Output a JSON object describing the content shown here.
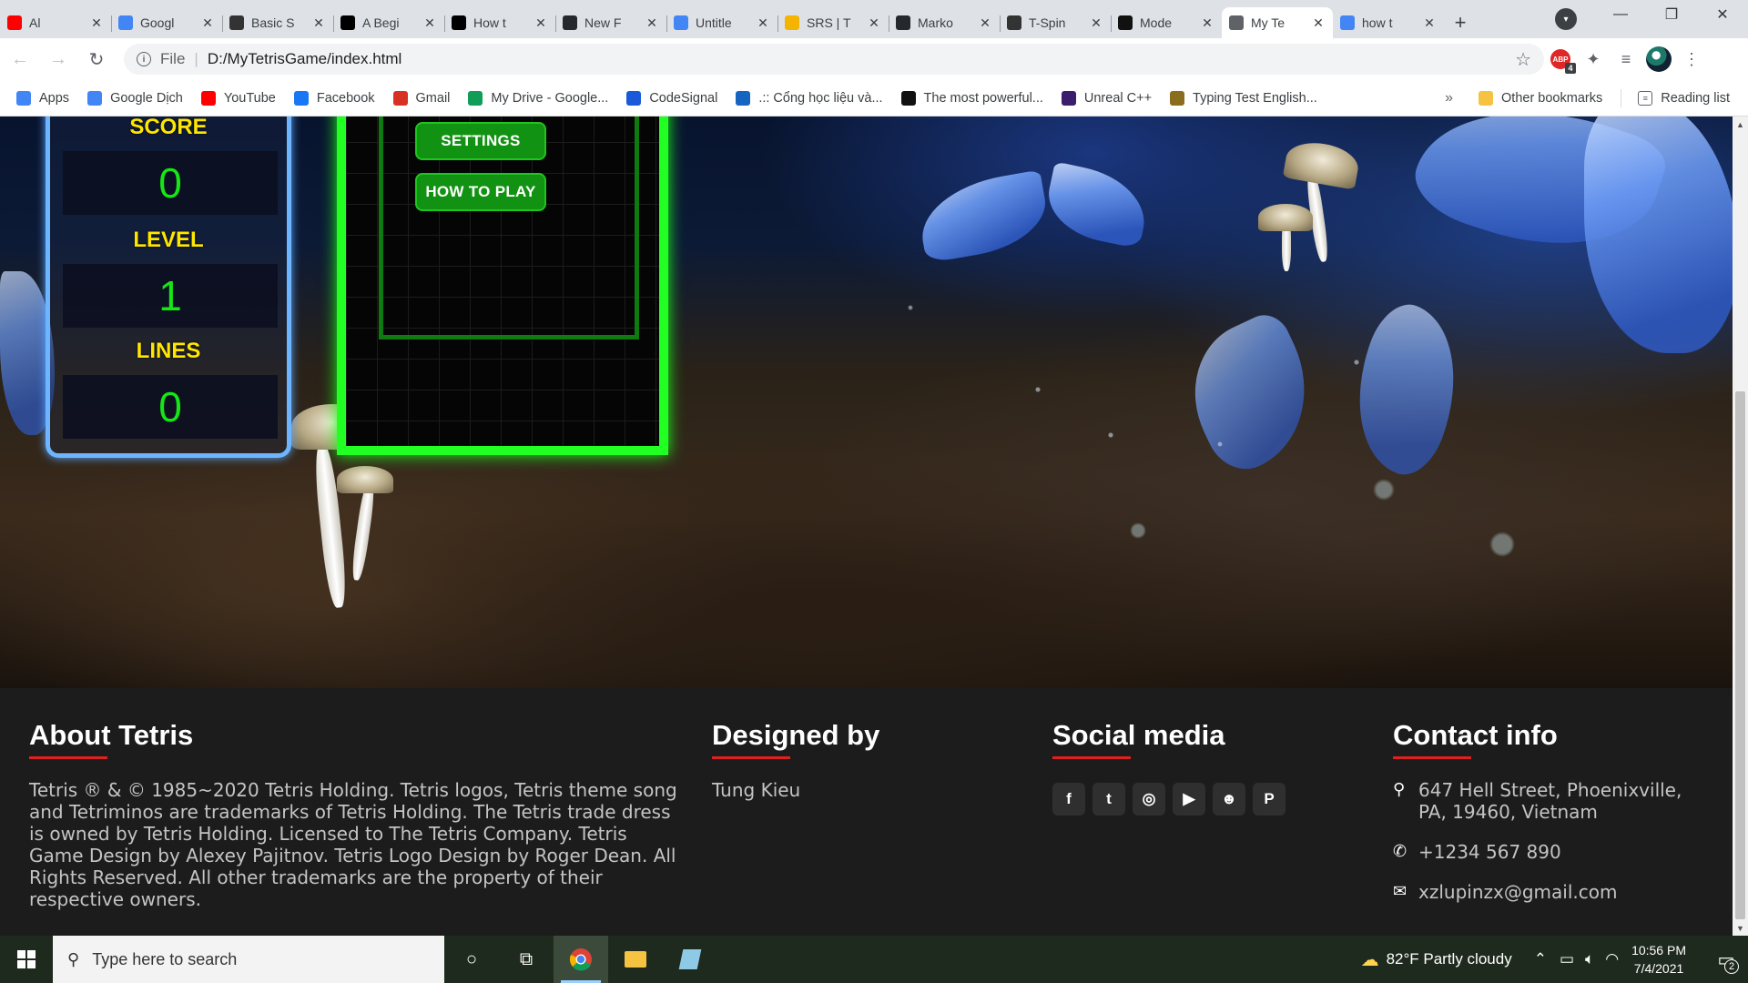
{
  "tabs": [
    {
      "title": "Al",
      "icon": "youtube-icon",
      "color": "#ff0000"
    },
    {
      "title": "Googl",
      "icon": "google-translate-icon",
      "color": "#4285f4"
    },
    {
      "title": "Basic S",
      "icon": "markdown-icon",
      "color": "#333333"
    },
    {
      "title": "A Begi",
      "icon": "medium-icon",
      "color": "#000000"
    },
    {
      "title": "How t",
      "icon": "dog-icon",
      "color": "#000000"
    },
    {
      "title": "New F",
      "icon": "github-icon",
      "color": "#24292e"
    },
    {
      "title": "Untitle",
      "icon": "google-docs-icon",
      "color": "#4285f4"
    },
    {
      "title": "SRS | T",
      "icon": "srs-icon",
      "color": "#f4b400"
    },
    {
      "title": "Marko",
      "icon": "github-icon",
      "color": "#24292e"
    },
    {
      "title": "T-Spin",
      "icon": "tspin-icon",
      "color": "#333333"
    },
    {
      "title": "Mode",
      "icon": "mode-icon",
      "color": "#111111"
    },
    {
      "title": "My Te",
      "icon": "globe-icon",
      "color": "#5f6368",
      "active": true
    },
    {
      "title": "how t",
      "icon": "google-icon",
      "color": "#4285f4"
    }
  ],
  "address": {
    "scheme_label": "File",
    "url": "D:/MyTetrisGame/index.html"
  },
  "extensions": {
    "abp_label": "ABP",
    "abp_badge": "4"
  },
  "bookmarks": [
    {
      "label": "Apps",
      "icon": "apps-grid-icon",
      "color": "#4285f4"
    },
    {
      "label": "Google Dịch",
      "icon": "google-translate-icon",
      "color": "#4285f4"
    },
    {
      "label": "YouTube",
      "icon": "youtube-icon",
      "color": "#ff0000"
    },
    {
      "label": "Facebook",
      "icon": "facebook-icon",
      "color": "#1877f2"
    },
    {
      "label": "Gmail",
      "icon": "gmail-icon",
      "color": "#d93025"
    },
    {
      "label": "My Drive - Google...",
      "icon": "google-drive-icon",
      "color": "#0f9d58"
    },
    {
      "label": "CodeSignal",
      "icon": "codesignal-icon",
      "color": "#1a5ad8"
    },
    {
      "label": ".:: Cổng học liệu và...",
      "icon": "portal-icon",
      "color": "#1565c0"
    },
    {
      "label": "The most powerful...",
      "icon": "unreal-icon",
      "color": "#111111"
    },
    {
      "label": "Unreal C++",
      "icon": "unreal-cpp-icon",
      "color": "#3b1d6e"
    },
    {
      "label": "Typing Test English...",
      "icon": "typing-test-icon",
      "color": "#8a6d1d"
    }
  ],
  "bookmarks_right": {
    "overflow": "»",
    "other": "Other bookmarks",
    "reading_list": "Reading list"
  },
  "game": {
    "score_label": "SCORE",
    "score": "0",
    "level_label": "LEVEL",
    "level": "1",
    "lines_label": "LINES",
    "lines": "0",
    "settings_button": "SETTINGS",
    "how_to_play_button": "HOW TO PLAY"
  },
  "footer": {
    "about_title": "About Tetris",
    "about_text": "Tetris ® & © 1985~2020 Tetris Holding. Tetris logos, Tetris theme song and Tetriminos are trademarks of Tetris Holding. The Tetris trade dress is owned by Tetris Holding. Licensed to The Tetris Company. Tetris Game Design by Alexey Pajitnov. Tetris Logo Design by Roger Dean. All Rights Reserved. All other trademarks are the property of their respective owners.",
    "designed_title": "Designed by",
    "designer": "Tung Kieu",
    "social_title": "Social media",
    "socials": [
      "facebook-icon",
      "twitter-icon",
      "instagram-icon",
      "youtube-icon",
      "snapchat-icon",
      "pinterest-icon"
    ],
    "contact_title": "Contact info",
    "address": "647 Hell Street, Phoenixville, PA, 19460, Vietnam",
    "phone": "+1234 567 890",
    "email": "xzlupinzx@gmail.com",
    "accent_color": "#e02020"
  },
  "taskbar": {
    "search_placeholder": "Type here to search",
    "weather": "82°F  Partly cloudy",
    "time": "10:56 PM",
    "date": "7/4/2021",
    "notification_count": "2"
  }
}
